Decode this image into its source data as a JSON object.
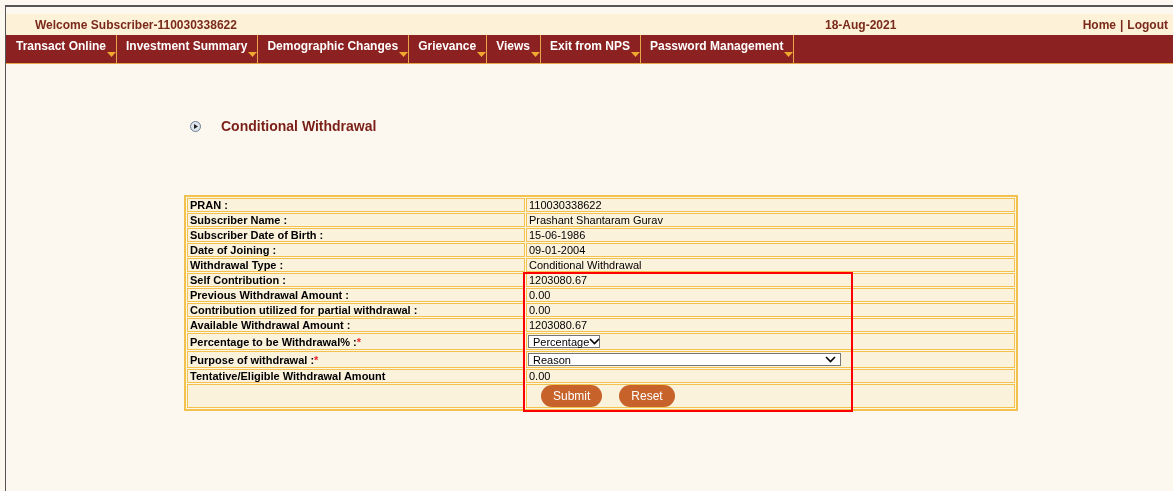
{
  "header": {
    "welcome": "Welcome Subscriber-110030338622",
    "date": "18-Aug-2021",
    "links": [
      {
        "label": "Home"
      },
      {
        "label": "Logout"
      }
    ],
    "link_separator": "|"
  },
  "menu": [
    {
      "label": "Transact Online"
    },
    {
      "label": "Investment Summary"
    },
    {
      "label": "Demographic Changes"
    },
    {
      "label": "Grievance"
    },
    {
      "label": "Views"
    },
    {
      "label": "Exit from NPS"
    },
    {
      "label": "Password Management"
    }
  ],
  "page_title": "Conditional Withdrawal",
  "form": {
    "rows": [
      {
        "kind": "text",
        "label": "PRAN :",
        "value": "110030338622"
      },
      {
        "kind": "text",
        "label": "Subscriber Name :",
        "value": "Prashant Shantaram Gurav"
      },
      {
        "kind": "text",
        "label": "Subscriber Date of Birth :",
        "value": "15-06-1986"
      },
      {
        "kind": "text",
        "label": "Date of Joining :",
        "value": "09-01-2004"
      },
      {
        "kind": "text",
        "label": "Withdrawal Type :",
        "value": "Conditional Withdrawal"
      },
      {
        "kind": "text",
        "label": "Self Contribution :",
        "value": "1203080.67"
      },
      {
        "kind": "text",
        "label": "Previous Withdrawal Amount :",
        "value": "0.00"
      },
      {
        "kind": "text",
        "label": "Contribution utilized for partial withdrawal :",
        "value": "0.00"
      },
      {
        "kind": "text",
        "label": "Available Withdrawal Amount :",
        "value": "1203080.67"
      },
      {
        "kind": "select",
        "label": "Percentage to be Withdrawal% :",
        "required_mark": "*",
        "value": "Percentage"
      },
      {
        "kind": "wideselect",
        "label": "Purpose of withdrawal :",
        "required_mark": "*",
        "value": "Reason"
      },
      {
        "kind": "text",
        "label": "Tentative/Eligible Withdrawal Amount",
        "value": "0.00"
      }
    ],
    "buttons": [
      {
        "label": "Submit"
      },
      {
        "label": "Reset"
      }
    ]
  }
}
